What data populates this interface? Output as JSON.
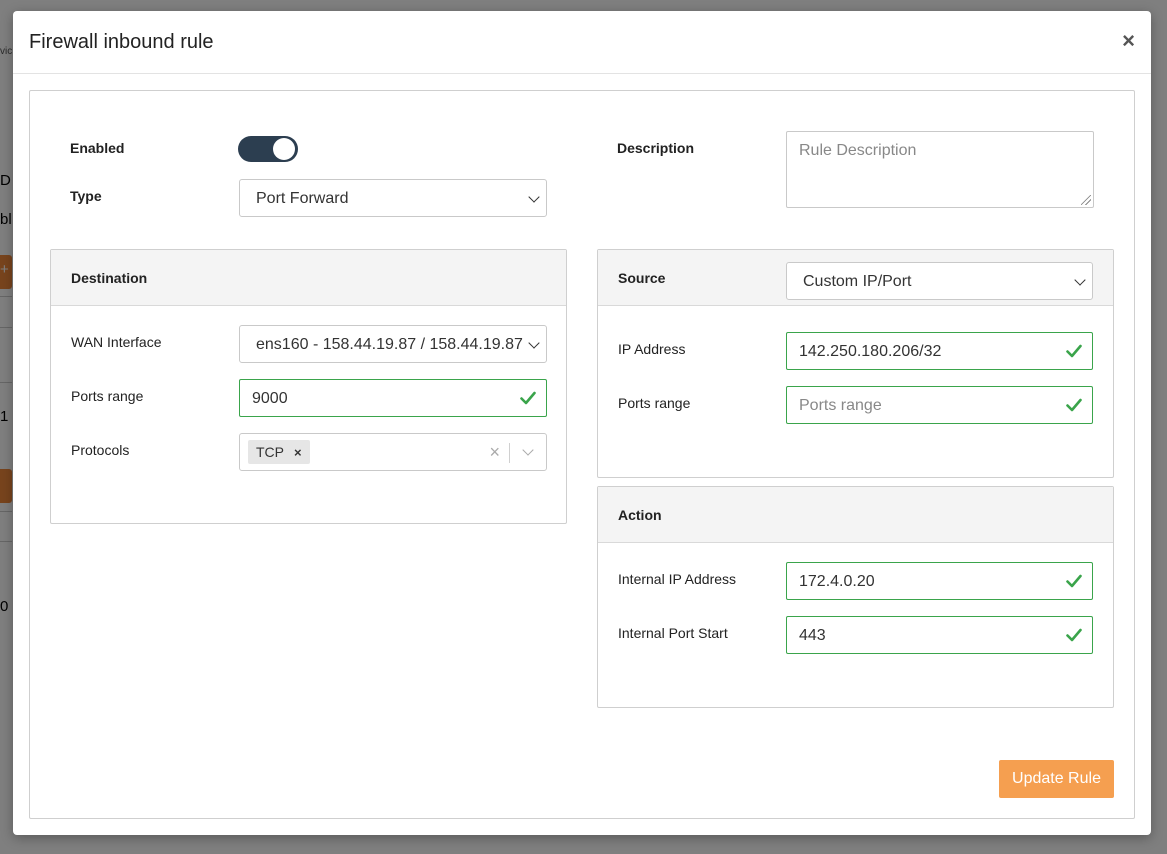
{
  "background": {
    "fragments": [
      "vic",
      "D",
      "bl",
      "+",
      "1",
      "0"
    ]
  },
  "modal": {
    "title": "Firewall inbound rule",
    "close_label": "×"
  },
  "general": {
    "enabled_label": "Enabled",
    "enabled": true,
    "type_label": "Type",
    "type_value": "Port Forward",
    "description_label": "Description",
    "description_placeholder": "Rule Description"
  },
  "destination": {
    "title": "Destination",
    "wan_label": "WAN Interface",
    "wan_value": "ens160 - 158.44.19.87 / 158.44.19.87",
    "ports_label": "Ports range",
    "ports_value": "9000",
    "protocols_label": "Protocols",
    "protocols": [
      "TCP"
    ],
    "tag_remove": "×",
    "clear_label": "×"
  },
  "source": {
    "title": "Source",
    "mode_value": "Custom IP/Port",
    "ip_label": "IP Address",
    "ip_value": "142.250.180.206/32",
    "ports_label": "Ports range",
    "ports_placeholder": "Ports range"
  },
  "action": {
    "title": "Action",
    "internal_ip_label": "Internal IP Address",
    "internal_ip_value": "172.4.0.20",
    "internal_port_label": "Internal Port Start",
    "internal_port_value": "443"
  },
  "footer": {
    "submit_label": "Update Rule"
  },
  "colors": {
    "toggle_on": "#2c3e50",
    "valid_green": "#3aa44b",
    "primary_orange": "#f59f50"
  }
}
